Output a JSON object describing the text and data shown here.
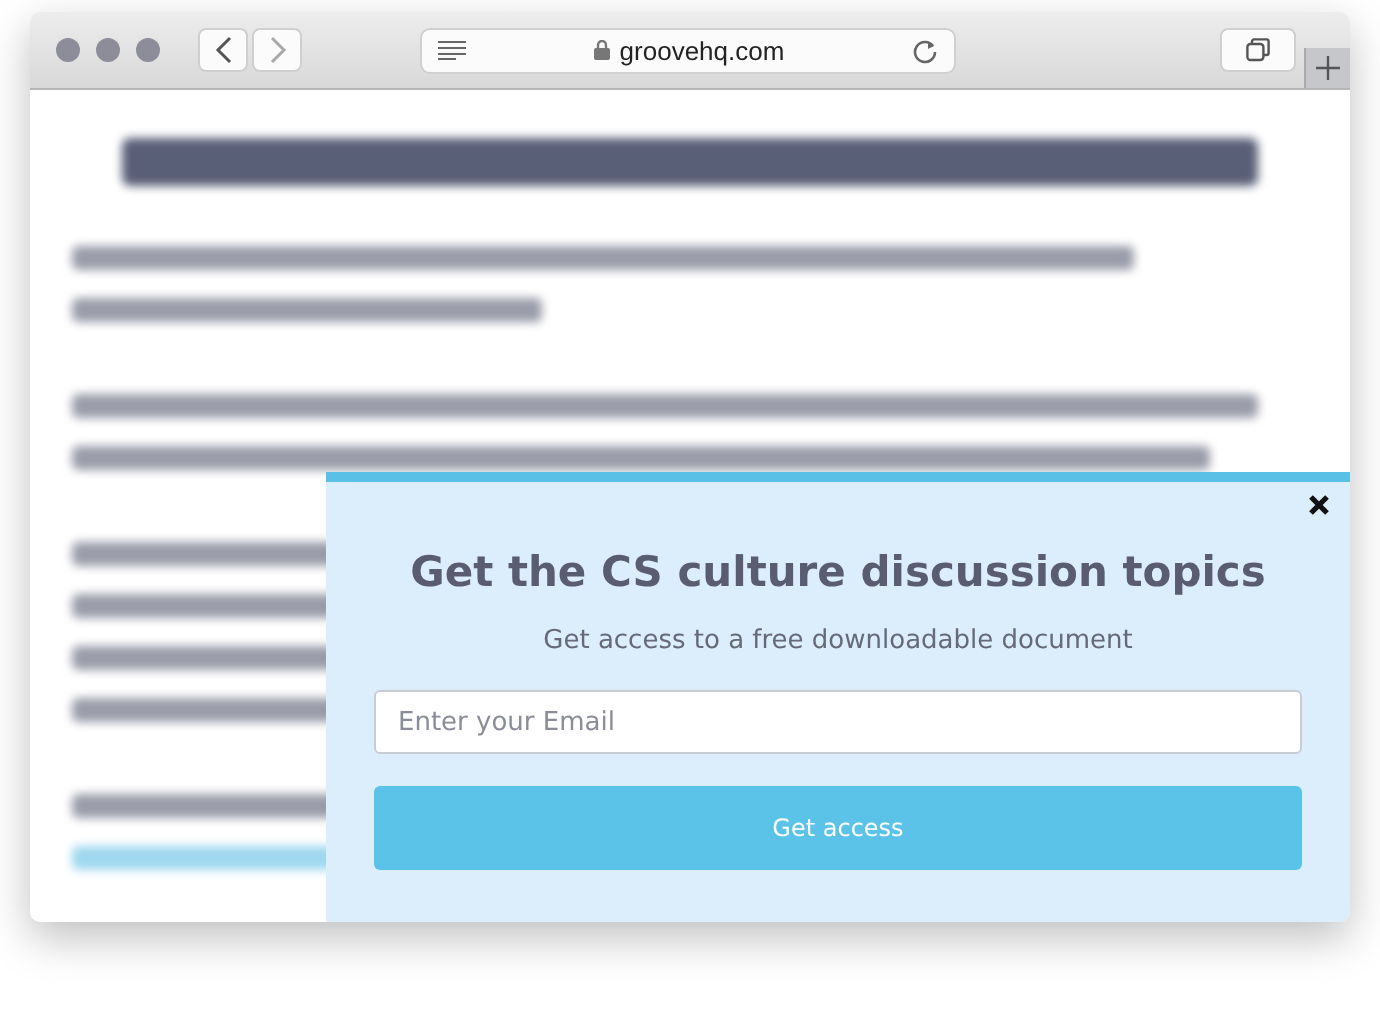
{
  "browser": {
    "url": "groovehq.com"
  },
  "popup": {
    "title": "Get the CS culture discussion topics",
    "subtitle": "Get access to a free downloadable document",
    "email": {
      "placeholder": "Enter your Email"
    },
    "button": "Get access"
  }
}
